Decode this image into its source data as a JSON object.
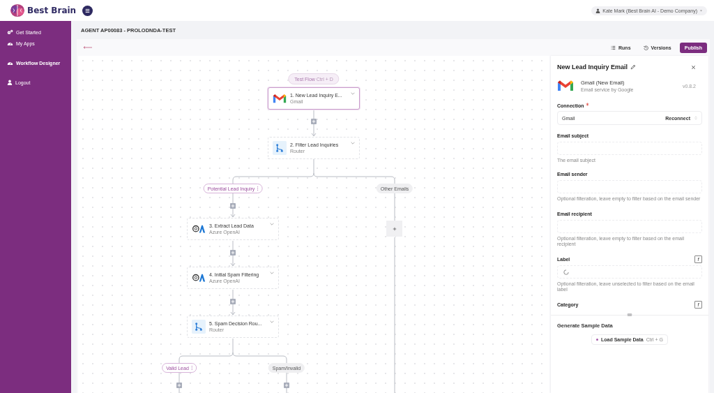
{
  "header": {
    "brand": "Best Brain",
    "user": "Kate Mark (Best Brain AI - Demo Company)"
  },
  "sidebar": {
    "items": [
      {
        "label": "Get Started",
        "kind": "gears",
        "selected": false
      },
      {
        "label": "My Apps",
        "kind": "gauge",
        "selected": false
      },
      {
        "label": "Workflow Designer",
        "kind": "gauge",
        "selected": true
      },
      {
        "label": "Logout",
        "kind": "user",
        "selected": false
      }
    ]
  },
  "page": {
    "title": "AGENT AP00083 - PROLODNDA-TEST"
  },
  "toolbar": {
    "buttons": [
      {
        "label": "Runs",
        "kind": "list"
      },
      {
        "label": "Versions",
        "kind": "history"
      },
      {
        "label": "Publish",
        "kind": "primary"
      }
    ]
  },
  "flow": {
    "test_flow": {
      "label": "Test Flow",
      "shortcut": "Ctrl + D"
    },
    "steps": [
      {
        "title": "1. New Lead Inquiry E...",
        "subtitle": "Gmail",
        "kind": "gmail",
        "selected": true
      },
      {
        "title": "2. Filter Lead Inquiries",
        "subtitle": "Router",
        "kind": "router",
        "selected": false
      },
      {
        "title": "3. Extract Lead Data",
        "subtitle": "Azure OpenAI",
        "kind": "azure",
        "selected": false
      },
      {
        "title": "4. Initial Spam Filtering",
        "subtitle": "Azure OpenAI",
        "kind": "azure",
        "selected": false
      },
      {
        "title": "5. Spam Decision Rou...",
        "subtitle": "Router",
        "kind": "router",
        "selected": false
      }
    ],
    "branches": [
      {
        "label": "Potential Lead Inquiry",
        "selected": true
      },
      {
        "label": "Other Emails",
        "selected": false
      },
      {
        "label": "Valid Lead",
        "selected": true
      },
      {
        "label": "Spam/Invalid",
        "selected": false
      }
    ]
  },
  "panel": {
    "title": "New Lead Inquiry Email",
    "app_name": "Gmail (New Email)",
    "app_description": "Email service by Google",
    "version": "v0.8.2",
    "connection": {
      "label": "Connection",
      "required": true,
      "value": "Gmail",
      "action": "Reconnect"
    },
    "fields": [
      {
        "label": "Email subject",
        "kind": "text",
        "help": "The email subject"
      },
      {
        "label": "Email sender",
        "kind": "text",
        "help": "Optional filteration, leave empty to filter based on the email sender"
      },
      {
        "label": "Email recipient",
        "kind": "text",
        "help": "Optional filteration, leave empty to filter based on the email recipient"
      },
      {
        "label": "Label",
        "kind": "loading",
        "toggle": "f",
        "help": "Optional filteration, leave unselected to filter based on the email label"
      },
      {
        "label": "Category",
        "toggle": "f"
      }
    ],
    "sample": {
      "title": "Generate Sample Data",
      "button": "Load Sample Data",
      "shortcut": "Ctrl + G"
    }
  }
}
